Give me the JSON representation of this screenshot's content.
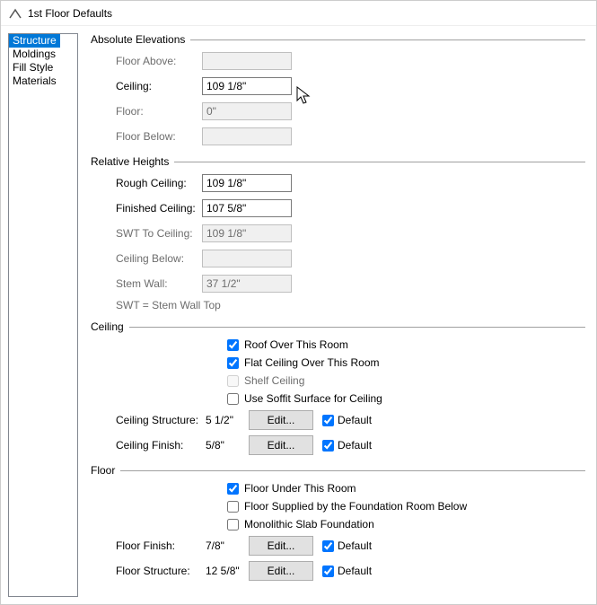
{
  "title": "1st Floor Defaults",
  "sidebar": {
    "items": [
      {
        "label": "Structure"
      },
      {
        "label": "Moldings"
      },
      {
        "label": "Fill Style"
      },
      {
        "label": "Materials"
      }
    ]
  },
  "absolute": {
    "header": "Absolute Elevations",
    "floor_above_label": "Floor Above:",
    "floor_above_value": "",
    "ceiling_label": "Ceiling:",
    "ceiling_value": "109 1/8\"",
    "floor_label": "Floor:",
    "floor_value": "0\"",
    "floor_below_label": "Floor Below:",
    "floor_below_value": ""
  },
  "relative": {
    "header": "Relative Heights",
    "rough_ceiling_label": "Rough Ceiling:",
    "rough_ceiling_value": "109 1/8\"",
    "finished_ceiling_label": "Finished Ceiling:",
    "finished_ceiling_value": "107 5/8\"",
    "swt_label": "SWT To Ceiling:",
    "swt_value": "109 1/8\"",
    "ceiling_below_label": "Ceiling Below:",
    "ceiling_below_value": "",
    "stem_wall_label": "Stem Wall:",
    "stem_wall_value": "37 1/2\"",
    "note": "SWT = Stem Wall Top"
  },
  "ceiling": {
    "header": "Ceiling",
    "roof_over": "Roof Over This Room",
    "flat_ceiling": "Flat Ceiling Over This Room",
    "shelf": "Shelf Ceiling",
    "soffit": "Use Soffit Surface for Ceiling",
    "structure_label": "Ceiling Structure:",
    "structure_value": "5 1/2\"",
    "finish_label": "Ceiling Finish:",
    "finish_value": "5/8\"",
    "edit": "Edit...",
    "default": "Default"
  },
  "floor": {
    "header": "Floor",
    "under": "Floor Under This Room",
    "supplied": "Floor Supplied by the Foundation Room Below",
    "mono": "Monolithic Slab Foundation",
    "finish_label": "Floor Finish:",
    "finish_value": "7/8\"",
    "structure_label": "Floor Structure:",
    "structure_value": "12 5/8\"",
    "edit": "Edit...",
    "default": "Default"
  }
}
